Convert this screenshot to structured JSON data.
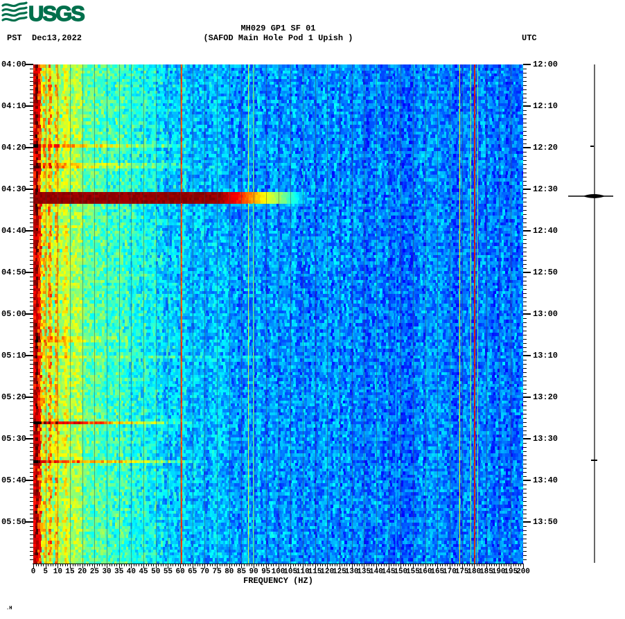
{
  "logo": {
    "text": "USGS",
    "color": "#00704C"
  },
  "header": {
    "tz_left": "PST",
    "date": "Dec13,2022",
    "title": "MH029 GP1 SF 01",
    "subtitle": "(SAFOD Main Hole Pod 1 Upish )",
    "tz_right": "UTC"
  },
  "footer": {
    "xlabel": "FREQUENCY (HZ)",
    "corner_mark": ".H"
  },
  "chart_data": {
    "type": "heatmap",
    "title": "MH029 GP1 SF 01",
    "subtitle": "(SAFOD Main Hole Pod 1 Upish )",
    "date": "Dec13,2022",
    "colormap": "jet",
    "x_axis": {
      "label": "FREQUENCY (HZ)",
      "min": 0,
      "max": 200,
      "major_tick_hz": 5,
      "minor_tick_hz": 1,
      "tick_labels": [
        0,
        5,
        10,
        15,
        20,
        25,
        30,
        35,
        40,
        45,
        50,
        55,
        60,
        65,
        70,
        75,
        80,
        85,
        90,
        95,
        100,
        105,
        110,
        115,
        120,
        125,
        130,
        135,
        140,
        145,
        150,
        155,
        160,
        165,
        170,
        175,
        180,
        185,
        190,
        195,
        200
      ]
    },
    "left_axis": {
      "timezone": "PST",
      "span_minutes": 120,
      "minor_tick_minutes": 1,
      "major_tick_minutes": 10,
      "tick_labels": [
        "04:00",
        "04:10",
        "04:20",
        "04:30",
        "04:40",
        "04:50",
        "05:00",
        "05:10",
        "05:20",
        "05:30",
        "05:40",
        "05:50"
      ]
    },
    "right_axis": {
      "timezone": "UTC",
      "tick_labels": [
        "12:00",
        "12:10",
        "12:20",
        "12:30",
        "12:40",
        "12:50",
        "13:00",
        "13:10",
        "13:20",
        "13:30",
        "13:40",
        "13:50"
      ]
    },
    "background_value_by_hz": [
      [
        0,
        0.975
      ],
      [
        1,
        0.9
      ],
      [
        2,
        0.8
      ],
      [
        3,
        0.72
      ],
      [
        5,
        0.66
      ],
      [
        8,
        0.615
      ],
      [
        12,
        0.575
      ],
      [
        18,
        0.525
      ],
      [
        25,
        0.47
      ],
      [
        35,
        0.43
      ],
      [
        45,
        0.39
      ],
      [
        55,
        0.34
      ],
      [
        70,
        0.3
      ],
      [
        90,
        0.275
      ],
      [
        120,
        0.255
      ],
      [
        200,
        0.235
      ]
    ],
    "noise_cell": {
      "w": 3,
      "h": 4,
      "amp": 0.085,
      "column_amp": 0.045
    },
    "low_freq_stripes": [
      {
        "hz": 1.5,
        "dv": 0.1
      },
      {
        "hz": 2.9,
        "dv": 0.09
      },
      {
        "hz": 3.8,
        "dv": -0.15
      },
      {
        "hz": 4.9,
        "dv": 0.07
      },
      {
        "hz": 5.7,
        "dv": -0.11
      },
      {
        "hz": 6.7,
        "dv": 0.11
      },
      {
        "hz": 8.1,
        "dv": -0.09
      },
      {
        "hz": 9.7,
        "dv": 0.08
      },
      {
        "hz": 11.6,
        "dv": -0.06
      },
      {
        "hz": 13.4,
        "dv": 0.05
      },
      {
        "hz": 15.8,
        "dv": -0.04
      }
    ],
    "persistent_lines": [
      {
        "hz": 60.2,
        "v": 0.8,
        "w": 2
      },
      {
        "hz": 87.8,
        "v": 0.57,
        "w": 1
      },
      {
        "hz": 89.6,
        "v": 0.44,
        "w": 2
      },
      {
        "hz": 148.0,
        "v": 0.33,
        "w": 1
      },
      {
        "hz": 174.0,
        "v": 0.63,
        "w": 1
      },
      {
        "hz": 178.6,
        "v": 0.55,
        "w": 1
      },
      {
        "hz": 179.8,
        "v": 0.85,
        "w": 2
      },
      {
        "hz": 181.2,
        "v": 0.5,
        "w": 1
      }
    ],
    "events": [
      {
        "pst": "04:19",
        "utc": "12:19",
        "t0": 19.0,
        "t1": 20.0,
        "hz_core": 30,
        "hz_end": 75,
        "dv": 0.16
      },
      {
        "pst": "04:24",
        "utc": "12:24",
        "t0": 24.0,
        "t1": 25.0,
        "hz_core": 30,
        "hz_end": 82,
        "dv": 0.12
      },
      {
        "pst": "04:31",
        "utc": "12:31",
        "t0": 30.8,
        "t1": 33.3,
        "saturate": true,
        "profile": [
          [
            0,
            0.98
          ],
          [
            76,
            0.98
          ],
          [
            84,
            0.85
          ],
          [
            92,
            0.67
          ],
          [
            102,
            0.5
          ],
          [
            110,
            0.32
          ],
          [
            116,
            0.0
          ]
        ]
      },
      {
        "pst": "05:06",
        "utc": "13:06",
        "t0": 65.5,
        "t1": 66.5,
        "hz_core": 18,
        "hz_end": 48,
        "dv": 0.09
      },
      {
        "pst": "05:10",
        "utc": "13:10",
        "t0": 70.0,
        "t1": 70.7,
        "hz_core": 55,
        "hz_end": 95,
        "dv": 0.07
      },
      {
        "pst": "05:26",
        "utc": "13:26",
        "t0": 85.8,
        "t1": 86.8,
        "hz_core": 28,
        "hz_end": 72,
        "dv": 0.3
      },
      {
        "pst": "05:35",
        "utc": "13:35",
        "t0": 94.8,
        "t1": 95.8,
        "hz_core": 34,
        "hz_end": 78,
        "dv": 0.24
      }
    ],
    "gridlines": {
      "every_hz": 5,
      "color": "rgba(68,68,68,0.45)"
    },
    "seismogram": {
      "present": true,
      "deflections": [
        {
          "pst": "04:20",
          "size": "tiny"
        },
        {
          "pst": "04:31",
          "size": "large"
        },
        {
          "pst": "05:35",
          "size": "small"
        }
      ]
    }
  }
}
